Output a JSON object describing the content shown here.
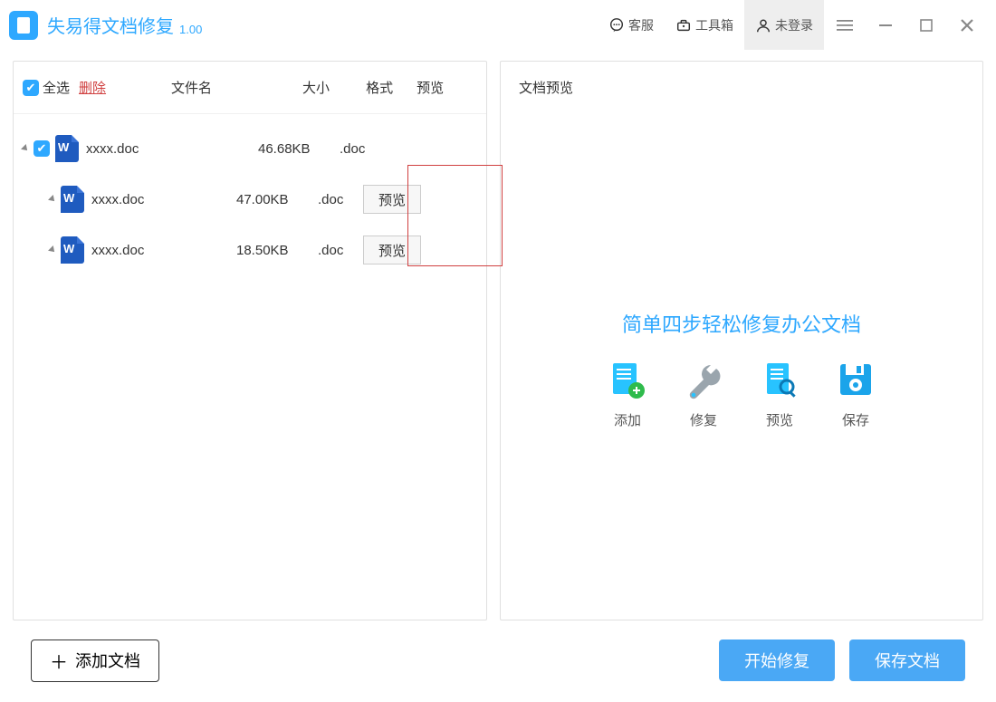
{
  "title": {
    "name": "失易得文档修复",
    "version": "1.00"
  },
  "top": {
    "kefu": "客服",
    "toolbox": "工具箱",
    "login": "未登录"
  },
  "list": {
    "select_all": "全选",
    "delete": "删除",
    "col_name": "文件名",
    "col_size": "大小",
    "col_ext": "格式",
    "col_prev": "预览",
    "rows": [
      {
        "name": "xxxx.doc",
        "size": "46.68KB",
        "ext": ".doc",
        "checked": true,
        "preview": false
      },
      {
        "name": "xxxx.doc",
        "size": "47.00KB",
        "ext": ".doc",
        "checked": false,
        "preview": true
      },
      {
        "name": "xxxx.doc",
        "size": "18.50KB",
        "ext": ".doc",
        "checked": false,
        "preview": true
      }
    ],
    "preview_label": "预览"
  },
  "preview": {
    "title": "文档预览",
    "slogan": "简单四步轻松修复办公文档",
    "steps": [
      {
        "label": "添加"
      },
      {
        "label": "修复"
      },
      {
        "label": "预览"
      },
      {
        "label": "保存"
      }
    ]
  },
  "footer": {
    "add": "添加文档",
    "repair": "开始修复",
    "save": "保存文档"
  }
}
